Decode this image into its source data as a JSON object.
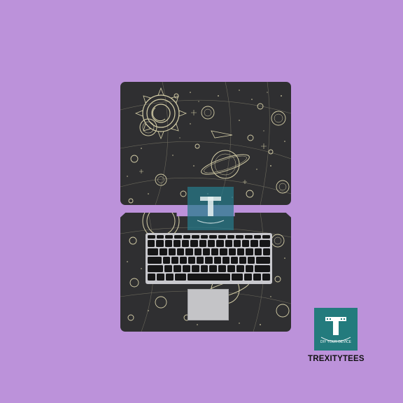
{
  "brand": {
    "name": "TREXITYTEES",
    "logo_letter": "T",
    "logo_tagline": "DIY YOUR DEVICE"
  },
  "colors": {
    "background": "#bc92da",
    "skin_base": "#2f2f31",
    "line_art": "#d6cfa8",
    "logo_bg": "#237b7d"
  },
  "product": {
    "pattern": "celestial sun, moon and planets line art"
  }
}
